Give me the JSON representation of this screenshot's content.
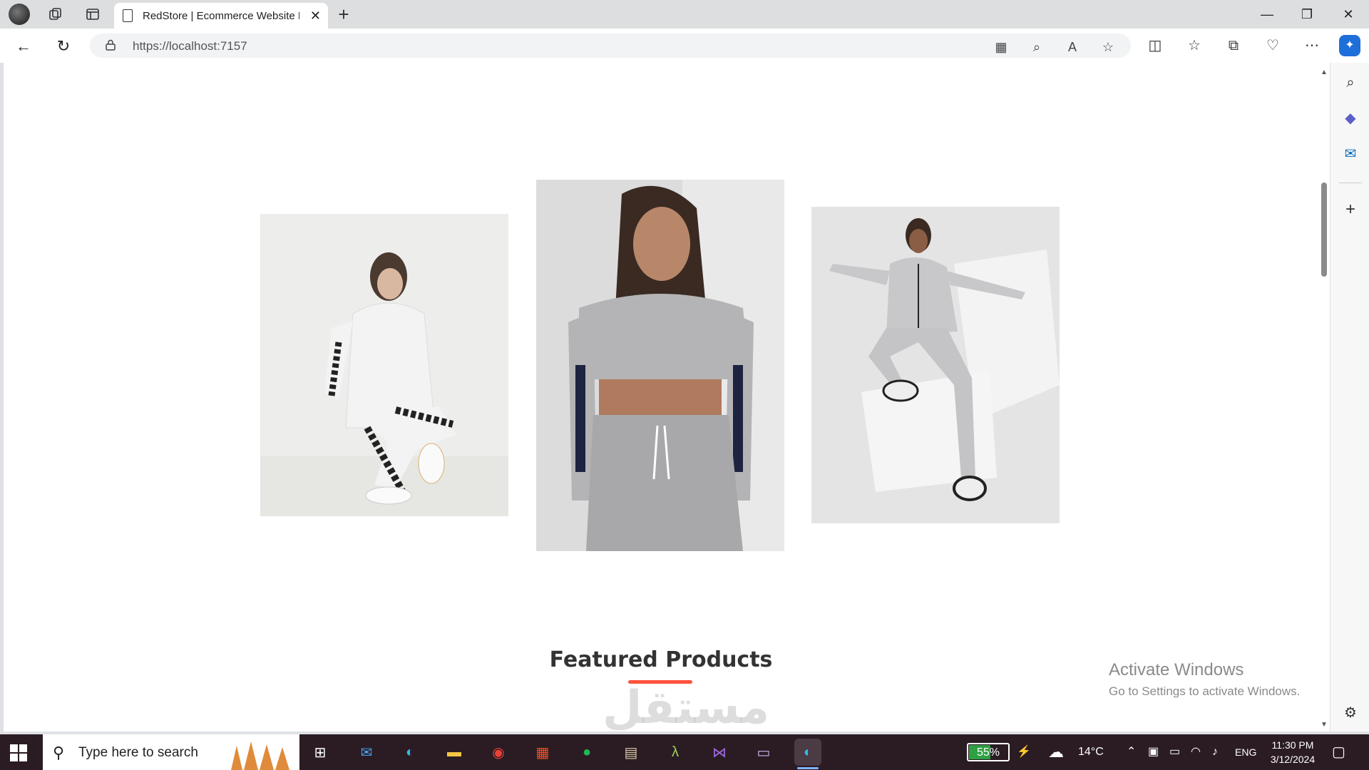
{
  "browser": {
    "tab_title": "RedStore | Ecommerce Website Design",
    "url": "https://localhost:7157"
  },
  "page": {
    "section_title": "Featured Products",
    "watermark_text": "مستقل mostaql.com",
    "categories": [
      {
        "alt": "Woman in white hoodie and striped joggers"
      },
      {
        "alt": "Woman in grey crop sweatshirt and joggers"
      },
      {
        "alt": "Woman in grey tracksuit posing on white block"
      }
    ]
  },
  "windows_notice": {
    "line1": "Activate Windows",
    "line2": "Go to Settings to activate Windows."
  },
  "taskbar": {
    "search_placeholder": "Type here to search",
    "battery": "55%",
    "weather": "14°C",
    "language": "ENG",
    "time": "11:30 PM",
    "date": "3/12/2024",
    "accent_color": "#ff523b"
  }
}
